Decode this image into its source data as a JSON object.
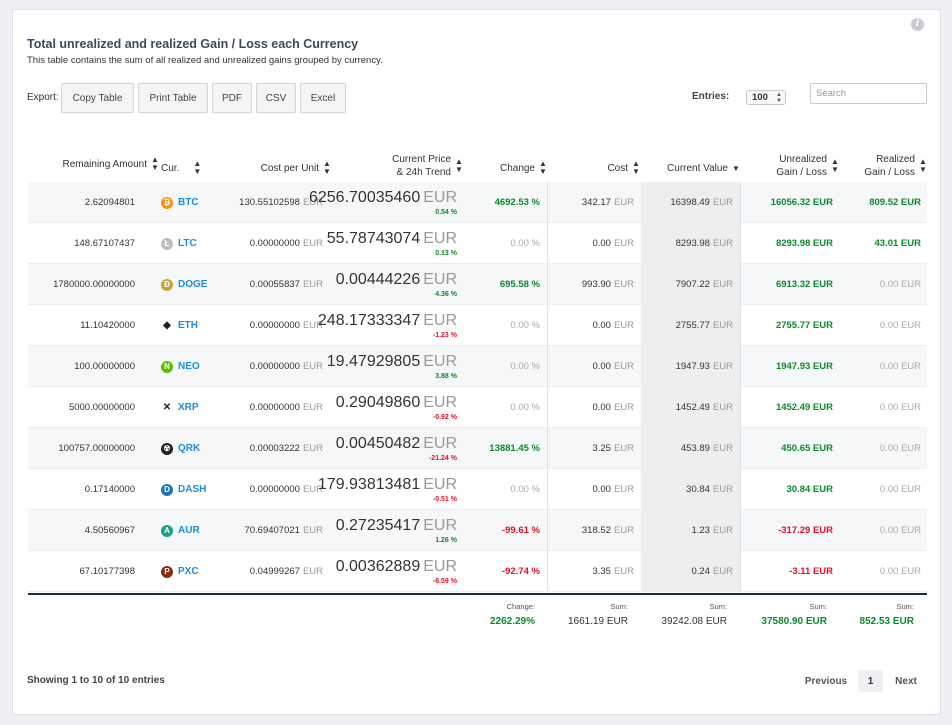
{
  "title": "Total unrealized and realized Gain / Loss each Currency",
  "subtitle": "This table contains the sum of all realized and unrealized gains grouped by currency.",
  "export": {
    "label": "Export:",
    "buttons": [
      "Copy Table",
      "Print Table",
      "PDF",
      "CSV",
      "Excel"
    ]
  },
  "entries": {
    "label": "Entries:",
    "value": "100"
  },
  "search": {
    "placeholder": "Search"
  },
  "columns": {
    "remaining": "Remaining Amount",
    "cur": "Cur.",
    "cost_per_unit": "Cost per Unit",
    "price_l1": "Current Price",
    "price_l2": "& 24h Trend",
    "change": "Change",
    "cost": "Cost",
    "current_value": "Current Value",
    "unrealized_l1": "Unrealized",
    "unrealized_l2": "Gain / Loss",
    "realized_l1": "Realized",
    "realized_l2": "Gain / Loss"
  },
  "unit": "EUR",
  "rows": [
    {
      "remaining": "2.62094801",
      "cur": "BTC",
      "icon": "bitcoin-icon",
      "icon_color": "#f7931a",
      "icon_glyph": "₿",
      "cpu": "130.55102598",
      "price": "6256.70035460",
      "trend": "0.54 %",
      "trend_dir": "up",
      "change": "4692.53 %",
      "change_dir": "up",
      "cost": "342.17",
      "cv": "16398.49",
      "unreal": "16056.32 EUR",
      "unreal_dir": "up",
      "real": "809.52 EUR",
      "real_dir": "up"
    },
    {
      "remaining": "148.67107437",
      "cur": "LTC",
      "icon": "litecoin-icon",
      "icon_color": "#bfbfbf",
      "icon_glyph": "Ł",
      "cpu": "0.00000000",
      "price": "55.78743074",
      "trend": "0.13 %",
      "trend_dir": "up",
      "change": "0.00 %",
      "change_dir": "zero",
      "cost": "0.00",
      "cv": "8293.98",
      "unreal": "8293.98 EUR",
      "unreal_dir": "up",
      "real": "43.01 EUR",
      "real_dir": "up"
    },
    {
      "remaining": "1780000.00000000",
      "cur": "DOGE",
      "icon": "dogecoin-icon",
      "icon_color": "#c2a633",
      "icon_glyph": "Ð",
      "cpu": "0.00055837",
      "price": "0.00444226",
      "trend": "4.36 %",
      "trend_dir": "up",
      "change": "695.58 %",
      "change_dir": "up",
      "cost": "993.90",
      "cv": "7907.22",
      "unreal": "6913.32 EUR",
      "unreal_dir": "up",
      "real": "0.00 EUR",
      "real_dir": "zero"
    },
    {
      "remaining": "11.10420000",
      "cur": "ETH",
      "icon": "ethereum-icon",
      "icon_color": "transparent",
      "icon_glyph": "◆",
      "cpu": "0.00000000",
      "price": "248.17333347",
      "trend": "-1.23 %",
      "trend_dir": "down",
      "change": "0.00 %",
      "change_dir": "zero",
      "cost": "0.00",
      "cv": "2755.77",
      "unreal": "2755.77 EUR",
      "unreal_dir": "up",
      "real": "0.00 EUR",
      "real_dir": "zero"
    },
    {
      "remaining": "100.00000000",
      "cur": "NEO",
      "icon": "neo-icon",
      "icon_color": "#58bf00",
      "icon_glyph": "N",
      "cpu": "0.00000000",
      "price": "19.47929805",
      "trend": "3.88 %",
      "trend_dir": "up",
      "change": "0.00 %",
      "change_dir": "zero",
      "cost": "0.00",
      "cv": "1947.93",
      "unreal": "1947.93 EUR",
      "unreal_dir": "up",
      "real": "0.00 EUR",
      "real_dir": "zero"
    },
    {
      "remaining": "5000.00000000",
      "cur": "XRP",
      "icon": "ripple-icon",
      "icon_color": "transparent",
      "icon_glyph": "✕",
      "cpu": "0.00000000",
      "price": "0.29049860",
      "trend": "-0.92 %",
      "trend_dir": "down",
      "change": "0.00 %",
      "change_dir": "zero",
      "cost": "0.00",
      "cv": "1452.49",
      "unreal": "1452.49 EUR",
      "unreal_dir": "up",
      "real": "0.00 EUR",
      "real_dir": "zero"
    },
    {
      "remaining": "100757.00000000",
      "cur": "QRK",
      "icon": "quark-icon",
      "icon_color": "#222222",
      "icon_glyph": "☢",
      "cpu": "0.00003222",
      "price": "0.00450482",
      "trend": "-21.24 %",
      "trend_dir": "down",
      "change": "13881.45 %",
      "change_dir": "up",
      "cost": "3.25",
      "cv": "453.89",
      "unreal": "450.65 EUR",
      "unreal_dir": "up",
      "real": "0.00 EUR",
      "real_dir": "zero"
    },
    {
      "remaining": "0.17140000",
      "cur": "DASH",
      "icon": "dash-icon",
      "icon_color": "#1c75bc",
      "icon_glyph": "D",
      "cpu": "0.00000000",
      "price": "179.93813481",
      "trend": "-0.51 %",
      "trend_dir": "down",
      "change": "0.00 %",
      "change_dir": "zero",
      "cost": "0.00",
      "cv": "30.84",
      "unreal": "30.84 EUR",
      "unreal_dir": "up",
      "real": "0.00 EUR",
      "real_dir": "zero"
    },
    {
      "remaining": "4.50560967",
      "cur": "AUR",
      "icon": "auroracoin-icon",
      "icon_color": "#1aa185",
      "icon_glyph": "A",
      "cpu": "70.69407021",
      "price": "0.27235417",
      "trend": "1.26 %",
      "trend_dir": "up",
      "change": "-99.61 %",
      "change_dir": "down",
      "cost": "318.52",
      "cv": "1.23",
      "unreal": "-317.29 EUR",
      "unreal_dir": "down",
      "real": "0.00 EUR",
      "real_dir": "zero"
    },
    {
      "remaining": "67.10177398",
      "cur": "PXC",
      "icon": "phoenixcoin-icon",
      "icon_color": "#8b2a12",
      "icon_glyph": "P",
      "cpu": "0.04999267",
      "price": "0.00362889",
      "trend": "-6.59 %",
      "trend_dir": "down",
      "change": "-92.74 %",
      "change_dir": "down",
      "cost": "3.35",
      "cv": "0.24",
      "unreal": "-3.11 EUR",
      "unreal_dir": "down",
      "real": "0.00 EUR",
      "real_dir": "zero"
    }
  ],
  "footer": {
    "change_label": "Change:",
    "change_value": "2262.29%",
    "cost_label": "Sum:",
    "cost_value": "1661.19 EUR",
    "cv_label": "Sum:",
    "cv_value": "39242.08 EUR",
    "unreal_label": "Sum:",
    "unreal_value": "37580.90 EUR",
    "real_label": "Sum:",
    "real_value": "852.53 EUR"
  },
  "showing": "Showing 1 to 10 of 10 entries",
  "pagination": {
    "previous": "Previous",
    "current": "1",
    "next": "Next"
  }
}
